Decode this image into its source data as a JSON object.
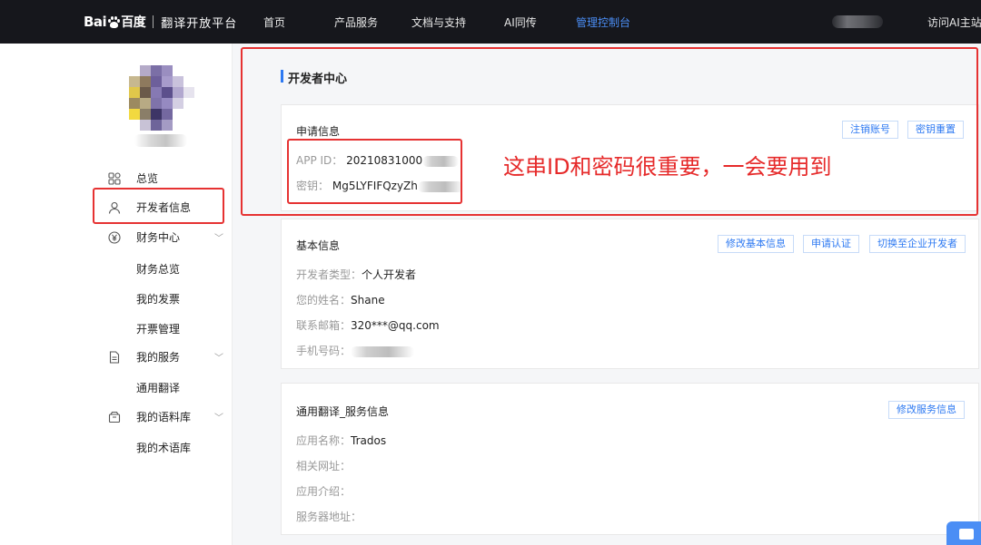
{
  "header": {
    "logo_text": "Bai",
    "logo_suffix": "百度",
    "platform": "翻译开放平台",
    "nav": [
      {
        "label": "首页"
      },
      {
        "label": "产品服务"
      },
      {
        "label": "文档与支持"
      },
      {
        "label": "AI同传"
      },
      {
        "label": "管理控制台",
        "active": true
      },
      {
        "label": "访问AI主站"
      }
    ]
  },
  "sidebar": {
    "items": [
      {
        "label": "总览",
        "icon": "grid-icon"
      },
      {
        "label": "开发者信息",
        "icon": "user-icon"
      },
      {
        "label": "财务中心",
        "icon": "yuan-icon",
        "expandable": true
      },
      {
        "label": "我的服务",
        "icon": "document-icon",
        "expandable": true
      },
      {
        "label": "我的语料库",
        "icon": "archive-icon",
        "expandable": true
      }
    ],
    "finance_sub": [
      "财务总览",
      "我的发票",
      "开票管理"
    ],
    "service_sub": [
      "通用翻译"
    ],
    "corpus_sub": [
      "我的术语库"
    ]
  },
  "main": {
    "title": "开发者中心",
    "apply": {
      "title": "申请信息",
      "buttons": [
        "注销账号",
        "密钥重置"
      ],
      "app_id_label": "APP ID：",
      "app_id_value": "20210831000",
      "secret_label": "密钥：",
      "secret_value": "Mg5LYFIFQzyZh"
    },
    "basic": {
      "title": "基本信息",
      "buttons": [
        "修改基本信息",
        "申请认证",
        "切换至企业开发者"
      ],
      "fields": [
        {
          "label": "开发者类型：",
          "value": "个人开发者"
        },
        {
          "label": "您的姓名：",
          "value": "Shane"
        },
        {
          "label": "联系邮箱：",
          "value": "320***@qq.com"
        },
        {
          "label": "手机号码：",
          "value": ""
        }
      ]
    },
    "service": {
      "title": "通用翻译_服务信息",
      "button": "修改服务信息",
      "fields": [
        {
          "label": "应用名称：",
          "value": "Trados"
        },
        {
          "label": "相关网址：",
          "value": ""
        },
        {
          "label": "应用介绍：",
          "value": ""
        },
        {
          "label": "服务器地址：",
          "value": ""
        }
      ]
    }
  },
  "annotation": {
    "note": "这串ID和密码很重要，一会要用到",
    "color": "#e63232"
  }
}
